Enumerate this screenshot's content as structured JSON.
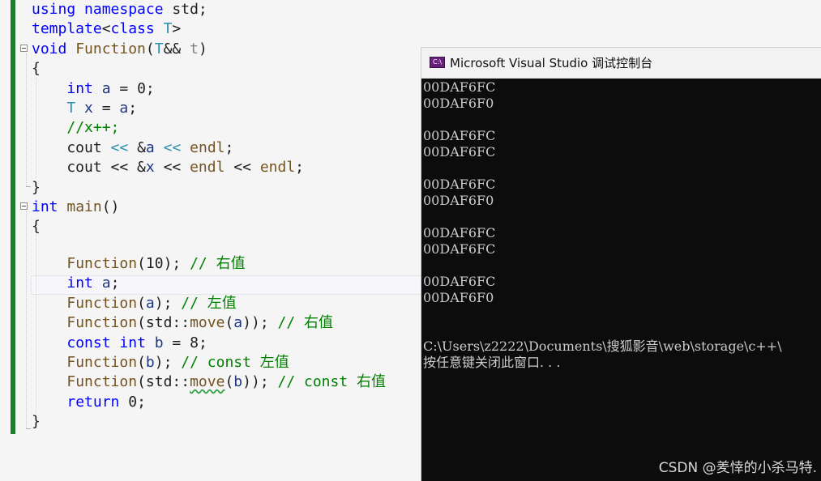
{
  "editor": {
    "lines": [
      [
        {
          "c": "kw",
          "t": "using"
        },
        {
          "c": "pl",
          "t": " "
        },
        {
          "c": "kw",
          "t": "namespace"
        },
        {
          "c": "pl",
          "t": " std;"
        }
      ],
      [
        {
          "c": "kw",
          "t": "template"
        },
        {
          "c": "pl",
          "t": "<"
        },
        {
          "c": "kw",
          "t": "class"
        },
        {
          "c": "pl",
          "t": " "
        },
        {
          "c": "tp",
          "t": "T"
        },
        {
          "c": "pl",
          "t": ">"
        }
      ],
      [
        {
          "c": "kw",
          "t": "void"
        },
        {
          "c": "pl",
          "t": " "
        },
        {
          "c": "fn",
          "t": "Function"
        },
        {
          "c": "pl",
          "t": "("
        },
        {
          "c": "tp",
          "t": "T"
        },
        {
          "c": "pl",
          "t": "&& "
        },
        {
          "c": "pr",
          "t": "t"
        },
        {
          "c": "pl",
          "t": ")"
        }
      ],
      [
        {
          "c": "pl",
          "t": "{"
        }
      ],
      [
        {
          "c": "pl",
          "t": "    "
        },
        {
          "c": "kw",
          "t": "int"
        },
        {
          "c": "pl",
          "t": " "
        },
        {
          "c": "vr",
          "t": "a"
        },
        {
          "c": "pl",
          "t": " = 0;"
        }
      ],
      [
        {
          "c": "pl",
          "t": "    "
        },
        {
          "c": "tp",
          "t": "T"
        },
        {
          "c": "pl",
          "t": " "
        },
        {
          "c": "vr",
          "t": "x"
        },
        {
          "c": "pl",
          "t": " = "
        },
        {
          "c": "vr",
          "t": "a"
        },
        {
          "c": "pl",
          "t": ";"
        }
      ],
      [
        {
          "c": "pl",
          "t": "    "
        },
        {
          "c": "cm",
          "t": "//x++;"
        }
      ],
      [
        {
          "c": "pl",
          "t": "    cout "
        },
        {
          "c": "tp",
          "t": "<<"
        },
        {
          "c": "pl",
          "t": " &"
        },
        {
          "c": "vr",
          "t": "a"
        },
        {
          "c": "pl",
          "t": " "
        },
        {
          "c": "tp",
          "t": "<<"
        },
        {
          "c": "pl",
          "t": " "
        },
        {
          "c": "fn",
          "t": "endl"
        },
        {
          "c": "pl",
          "t": ";"
        }
      ],
      [
        {
          "c": "pl",
          "t": "    cout << &"
        },
        {
          "c": "vr",
          "t": "x"
        },
        {
          "c": "pl",
          "t": " << "
        },
        {
          "c": "fn",
          "t": "endl"
        },
        {
          "c": "pl",
          "t": " << "
        },
        {
          "c": "fn",
          "t": "endl"
        },
        {
          "c": "pl",
          "t": ";"
        }
      ],
      [
        {
          "c": "pl",
          "t": "}"
        }
      ],
      [
        {
          "c": "kw",
          "t": "int"
        },
        {
          "c": "pl",
          "t": " "
        },
        {
          "c": "fn",
          "t": "main"
        },
        {
          "c": "pl",
          "t": "()"
        }
      ],
      [
        {
          "c": "pl",
          "t": "{"
        }
      ],
      [
        {
          "c": "pl",
          "t": ""
        }
      ],
      [
        {
          "c": "pl",
          "t": "    "
        },
        {
          "c": "fn",
          "t": "Function"
        },
        {
          "c": "pl",
          "t": "(10); "
        },
        {
          "c": "cm",
          "t": "// 右值"
        }
      ],
      [
        {
          "c": "pl",
          "t": "    "
        },
        {
          "c": "kw",
          "t": "int"
        },
        {
          "c": "pl",
          "t": " "
        },
        {
          "c": "vr",
          "t": "a"
        },
        {
          "c": "pl",
          "t": ";"
        }
      ],
      [
        {
          "c": "pl",
          "t": "    "
        },
        {
          "c": "fn",
          "t": "Function"
        },
        {
          "c": "pl",
          "t": "("
        },
        {
          "c": "vr",
          "t": "a"
        },
        {
          "c": "pl",
          "t": "); "
        },
        {
          "c": "cm",
          "t": "// 左值"
        }
      ],
      [
        {
          "c": "pl",
          "t": "    "
        },
        {
          "c": "fn",
          "t": "Function"
        },
        {
          "c": "pl",
          "t": "(std::"
        },
        {
          "c": "fn",
          "t": "move"
        },
        {
          "c": "pl",
          "t": "("
        },
        {
          "c": "vr",
          "t": "a"
        },
        {
          "c": "pl",
          "t": ")); "
        },
        {
          "c": "cm",
          "t": "// 右值"
        }
      ],
      [
        {
          "c": "pl",
          "t": "    "
        },
        {
          "c": "kw",
          "t": "const"
        },
        {
          "c": "pl",
          "t": " "
        },
        {
          "c": "kw",
          "t": "int"
        },
        {
          "c": "pl",
          "t": " "
        },
        {
          "c": "vr",
          "t": "b"
        },
        {
          "c": "pl",
          "t": " = 8;"
        }
      ],
      [
        {
          "c": "pl",
          "t": "    "
        },
        {
          "c": "fn",
          "t": "Function"
        },
        {
          "c": "pl",
          "t": "("
        },
        {
          "c": "vr",
          "t": "b"
        },
        {
          "c": "pl",
          "t": "); "
        },
        {
          "c": "cm",
          "t": "// const 左值"
        }
      ],
      [
        {
          "c": "pl",
          "t": "    "
        },
        {
          "c": "fn",
          "t": "Function"
        },
        {
          "c": "pl",
          "t": "(std::"
        },
        {
          "c": "fn",
          "t": "move",
          "sq": true
        },
        {
          "c": "pl",
          "t": "("
        },
        {
          "c": "vr",
          "t": "b"
        },
        {
          "c": "pl",
          "t": ")); "
        },
        {
          "c": "cm",
          "t": "// const 右值"
        }
      ],
      [
        {
          "c": "pl",
          "t": "    "
        },
        {
          "c": "kw",
          "t": "return"
        },
        {
          "c": "pl",
          "t": " 0;"
        }
      ],
      [
        {
          "c": "pl",
          "t": "}"
        }
      ]
    ]
  },
  "console": {
    "title": "Microsoft Visual Studio 调试控制台",
    "icon_label": "C:\\",
    "output": [
      "00DAF6FC",
      "00DAF6F0",
      "",
      "00DAF6FC",
      "00DAF6FC",
      "",
      "00DAF6FC",
      "00DAF6F0",
      "",
      "00DAF6FC",
      "00DAF6FC",
      "",
      "00DAF6FC",
      "00DAF6F0",
      "",
      "",
      "C:\\Users\\z2222\\Documents\\搜狐影音\\web\\storage\\c++\\",
      "按任意键关闭此窗口. . ."
    ]
  },
  "watermark": "CSDN @羑悻的小杀马特.",
  "colors": {
    "keyword": "#0000ff",
    "type": "#2b91af",
    "function": "#74531f",
    "parameter": "#808080",
    "variable": "#1f377f",
    "comment": "#008000",
    "change_bar": "#1b7f2a",
    "console_bg": "#0c0c0c",
    "console_text": "#cccccc"
  }
}
